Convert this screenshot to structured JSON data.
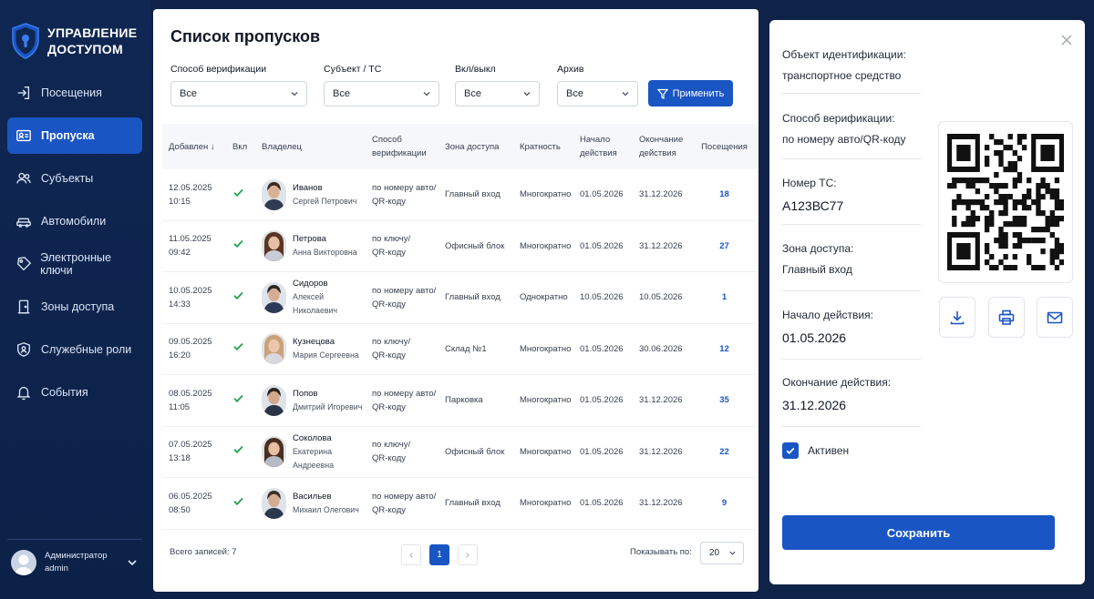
{
  "brand": {
    "line1": "УПРАВЛЕНИЕ",
    "line2": "ДОСТУПОМ",
    "icon": "shield-keyhole-icon"
  },
  "sidebar": {
    "items": [
      {
        "label": "Посещения",
        "icon": "login-icon",
        "active": false
      },
      {
        "label": "Пропуска",
        "icon": "id-card-icon",
        "active": true
      },
      {
        "label": "Субъекты",
        "icon": "users-icon",
        "active": false
      },
      {
        "label": "Автомобили",
        "icon": "car-icon",
        "active": false
      },
      {
        "label": "Электронные ключи",
        "icon": "key-tag-icon",
        "active": false
      },
      {
        "label": "Зоны доступа",
        "icon": "door-icon",
        "active": false
      },
      {
        "label": "Служебные роли",
        "icon": "shield-user-icon",
        "active": false
      },
      {
        "label": "События",
        "icon": "bell-icon",
        "active": false
      }
    ],
    "user": {
      "role": "Администратор",
      "login": "admin"
    }
  },
  "main": {
    "title": "Список пропусков",
    "filters": [
      {
        "label": "Способ верификации",
        "value": "Все"
      },
      {
        "label": "Субъект / ТС",
        "value": "Все"
      },
      {
        "label": "Вкл/выкл",
        "value": "Все"
      },
      {
        "label": "Архив",
        "value": "Все"
      }
    ],
    "apply_label": "Применить",
    "columns": {
      "added": "Добавлен ↓",
      "on": "Вкл",
      "owner": "Владелец",
      "method_1": "Способ",
      "method_2": "верификации",
      "zone": "Зона доступа",
      "multiplicity": "Кратность",
      "start_1": "Начало",
      "start_2": "действия",
      "end_1": "Окончание",
      "end_2": "действия",
      "visits": "Посещения"
    },
    "rows": [
      {
        "date": "12.05.2025",
        "time": "10:15",
        "surname": "Иванов",
        "name": "Сергей Петрович",
        "method_1": "по номеру авто/",
        "method_2": "QR-коду",
        "zone": "Главный вход",
        "multiplicity": "Многократно",
        "start": "01.05.2026",
        "end": "31.12.2026",
        "visits": "18"
      },
      {
        "date": "11.05.2025",
        "time": "09:42",
        "surname": "Петрова",
        "name": "Анна Викторовна",
        "method_1": "по ключу/",
        "method_2": "QR-коду",
        "zone": "Офисный блок",
        "multiplicity": "Многократно",
        "start": "01.05.2026",
        "end": "31.12.2026",
        "visits": "27"
      },
      {
        "date": "10.05.2025",
        "time": "14:33",
        "surname": "Сидоров",
        "name": "Алексей Николаевич",
        "method_1": "по номеру авто/",
        "method_2": "QR-коду",
        "zone": "Главный вход",
        "multiplicity": "Однократно",
        "start": "10.05.2026",
        "end": "10.05.2026",
        "visits": "1"
      },
      {
        "date": "09.05.2025",
        "time": "16:20",
        "surname": "Кузнецова",
        "name": "Мария Сергеевна",
        "method_1": "по ключу/",
        "method_2": "QR-коду",
        "zone": "Склад №1",
        "multiplicity": "Многократно",
        "start": "01.05.2026",
        "end": "30.06.2026",
        "visits": "12"
      },
      {
        "date": "08.05.2025",
        "time": "11:05",
        "surname": "Попов",
        "name": "Дмитрий Игоревич",
        "method_1": "по номеру авто/",
        "method_2": "QR-коду",
        "zone": "Парковка",
        "multiplicity": "Многократно",
        "start": "01.05.2026",
        "end": "31.12.2026",
        "visits": "35"
      },
      {
        "date": "07.05.2025",
        "time": "13:18",
        "surname": "Соколова",
        "name": "Екатерина Андреевна",
        "method_1": "по ключу/",
        "method_2": "QR-коду",
        "zone": "Офисный блок",
        "multiplicity": "Многократно",
        "start": "01.05.2026",
        "end": "31.12.2026",
        "visits": "22"
      },
      {
        "date": "06.05.2025",
        "time": "08:50",
        "surname": "Васильев",
        "name": "Михаил Олегович",
        "method_1": "по номеру авто/",
        "method_2": "QR-коду",
        "zone": "Главный вход",
        "multiplicity": "Многократно",
        "start": "01.05.2026",
        "end": "31.12.2026",
        "visits": "9"
      }
    ],
    "total": "Всего записей: 7",
    "page": "1",
    "per_page_label": "Показывать по:",
    "per_page": "20"
  },
  "detail": {
    "object_label": "Объект идентификации:",
    "object_value": "транспортное средство",
    "method_label": "Способ верификации:",
    "method_value": "по номеру авто/QR-коду",
    "plate_label": "Номер ТС:",
    "plate_value": "А123ВС77",
    "zone_label": "Зона доступа:",
    "zone_value": "Главный вход",
    "start_label": "Начало действия:",
    "start_value": "01.05.2026",
    "end_label": "Окончание действия:",
    "end_value": "31.12.2026",
    "active_label": "Активен",
    "save_label": "Сохранить"
  },
  "colors": {
    "accent": "#1a55c4",
    "sidebar": "#0f2752",
    "check": "#22a352"
  }
}
